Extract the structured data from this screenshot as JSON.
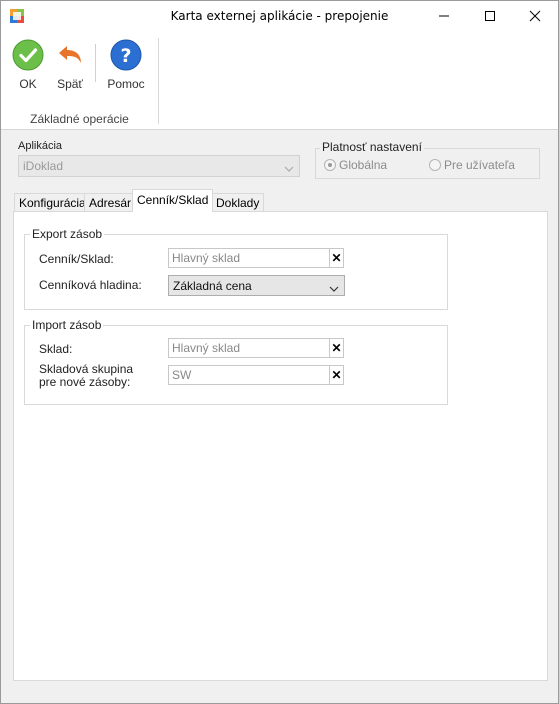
{
  "window": {
    "title": "Karta externej aplikácie - prepojenie"
  },
  "ribbon": {
    "buttons": [
      {
        "label": "OK",
        "icon": "ok-check-icon"
      },
      {
        "label": "Späť",
        "icon": "back-arrow-icon"
      },
      {
        "label": "Pomoc",
        "icon": "help-icon"
      }
    ],
    "group_label": "Základné operácie"
  },
  "application": {
    "label": "Aplikácia",
    "value": "iDoklad"
  },
  "validity": {
    "label": "Platnosť nastavení",
    "options": [
      {
        "label": "Globálna",
        "selected": true
      },
      {
        "label": "Pre užívateľa",
        "selected": false
      }
    ]
  },
  "tabs": [
    {
      "label": "Konfigurácia",
      "active": false
    },
    {
      "label": "Adresár",
      "active": false
    },
    {
      "label": "Cenník/Sklad",
      "active": true
    },
    {
      "label": "Doklady",
      "active": false
    }
  ],
  "export": {
    "title": "Export zásob",
    "price_list_label": "Cenník/Sklad:",
    "price_list_value": "Hlavný sklad",
    "price_level_label": "Cenníková hladina:",
    "price_level_value": "Základná cena"
  },
  "import": {
    "title": "Import zásob",
    "warehouse_label": "Sklad:",
    "warehouse_value": "Hlavný sklad",
    "group_label_line1": "Skladová skupina",
    "group_label_line2": "pre nové zásoby:",
    "group_value": "SW"
  },
  "colors": {
    "ok_green": "#6cc04a",
    "back_orange": "#e8742b",
    "help_blue": "#2a6fd1"
  }
}
